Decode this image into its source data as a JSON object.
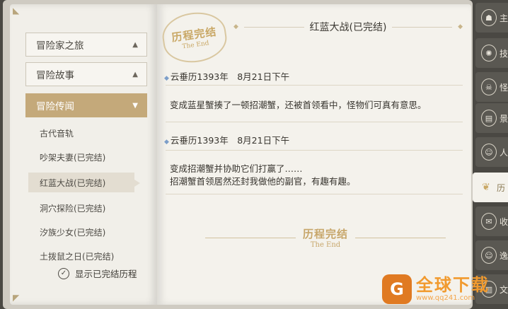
{
  "nav": {
    "categories": [
      {
        "label": "冒险家之旅",
        "chevron": "^"
      },
      {
        "label": "冒险故事",
        "chevron": "^"
      },
      {
        "label": "冒险传闻",
        "chevron": "v"
      }
    ],
    "items": [
      {
        "label": "古代音轨"
      },
      {
        "label": "吵架夫妻(已完结)"
      },
      {
        "label": "红蓝大战(已完结)"
      },
      {
        "label": "洞穴探险(已完结)"
      },
      {
        "label": "汐族少女(已完结)"
      },
      {
        "label": "土拨鼠之日(已完结)"
      }
    ],
    "show_completed": {
      "label": "显示已完结历程",
      "checked": true
    }
  },
  "badge": {
    "title": "历程完结",
    "subtitle": "The End"
  },
  "content": {
    "title": "红蓝大战(已完结)",
    "entries": [
      {
        "date": "云垂历1393年　8月21日下午",
        "lines": [
          "变成蓝星蟹揍了一顿招潮蟹，还被首领看中，怪物们可真有意思。"
        ]
      },
      {
        "date": "云垂历1393年　8月21日下午",
        "lines": [
          "变成招潮蟹并协助它们打赢了……",
          "招潮蟹首领居然还封我做他的副官，有趣有趣。"
        ]
      }
    ],
    "end": {
      "title": "历程完结",
      "subtitle": "The End"
    }
  },
  "side_tabs": [
    {
      "icon": "person-icon",
      "label": "主"
    },
    {
      "icon": "skill-icon",
      "label": "技"
    },
    {
      "icon": "mask-icon",
      "label": "怪"
    },
    {
      "icon": "scenery-icon",
      "label": "景"
    },
    {
      "icon": "people-icon",
      "label": "人"
    },
    {
      "icon": "wings-icon",
      "label": "历"
    },
    {
      "icon": "collection-icon",
      "label": "收"
    },
    {
      "icon": "people-icon",
      "label": "逸"
    },
    {
      "icon": "book-icon",
      "label": "文"
    }
  ],
  "watermark": {
    "title": "全球下载",
    "url": "www.qq241.com"
  },
  "colors": {
    "accent": "#c4a97a",
    "gold": "#c9a866",
    "blue_marker": "#7c9ec9"
  }
}
